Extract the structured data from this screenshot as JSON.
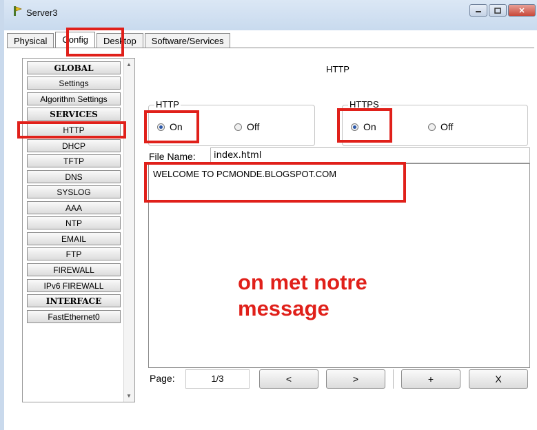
{
  "window": {
    "title": "Server3",
    "min_label": "▭",
    "max_label": "▣",
    "close_label": "✕"
  },
  "tabs": [
    {
      "label": "Physical",
      "active": false
    },
    {
      "label": "Config",
      "active": true
    },
    {
      "label": "Desktop",
      "active": false
    },
    {
      "label": "Software/Services",
      "active": false
    }
  ],
  "sidebar": {
    "items": [
      {
        "label": "GLOBAL",
        "header": true
      },
      {
        "label": "Settings",
        "header": false
      },
      {
        "label": "Algorithm Settings",
        "header": false
      },
      {
        "label": "SERVICES",
        "header": true
      },
      {
        "label": "HTTP",
        "header": false
      },
      {
        "label": "DHCP",
        "header": false
      },
      {
        "label": "TFTP",
        "header": false
      },
      {
        "label": "DNS",
        "header": false
      },
      {
        "label": "SYSLOG",
        "header": false
      },
      {
        "label": "AAA",
        "header": false
      },
      {
        "label": "NTP",
        "header": false
      },
      {
        "label": "EMAIL",
        "header": false
      },
      {
        "label": "FTP",
        "header": false
      },
      {
        "label": "FIREWALL",
        "header": false
      },
      {
        "label": "IPv6 FIREWALL",
        "header": false
      },
      {
        "label": "INTERFACE",
        "header": true
      },
      {
        "label": "FastEthernet0",
        "header": false
      }
    ]
  },
  "main": {
    "title": "HTTP",
    "http": {
      "legend": "HTTP",
      "on": "On",
      "off": "Off",
      "selected": "On"
    },
    "https": {
      "legend": "HTTPS",
      "on": "On",
      "off": "Off",
      "selected": "On"
    },
    "file_name_label": "File Name:",
    "file_name": "index.html",
    "content": "WELCOME TO PCMONDE.BLOGSPOT.COM",
    "page_label": "Page:",
    "page_value": "1/3",
    "prev_label": "<",
    "next_label": ">",
    "add_label": "+",
    "delete_label": "X"
  },
  "annotation": {
    "line1": "on met notre",
    "line2": "message",
    "color": "#e0201a"
  }
}
